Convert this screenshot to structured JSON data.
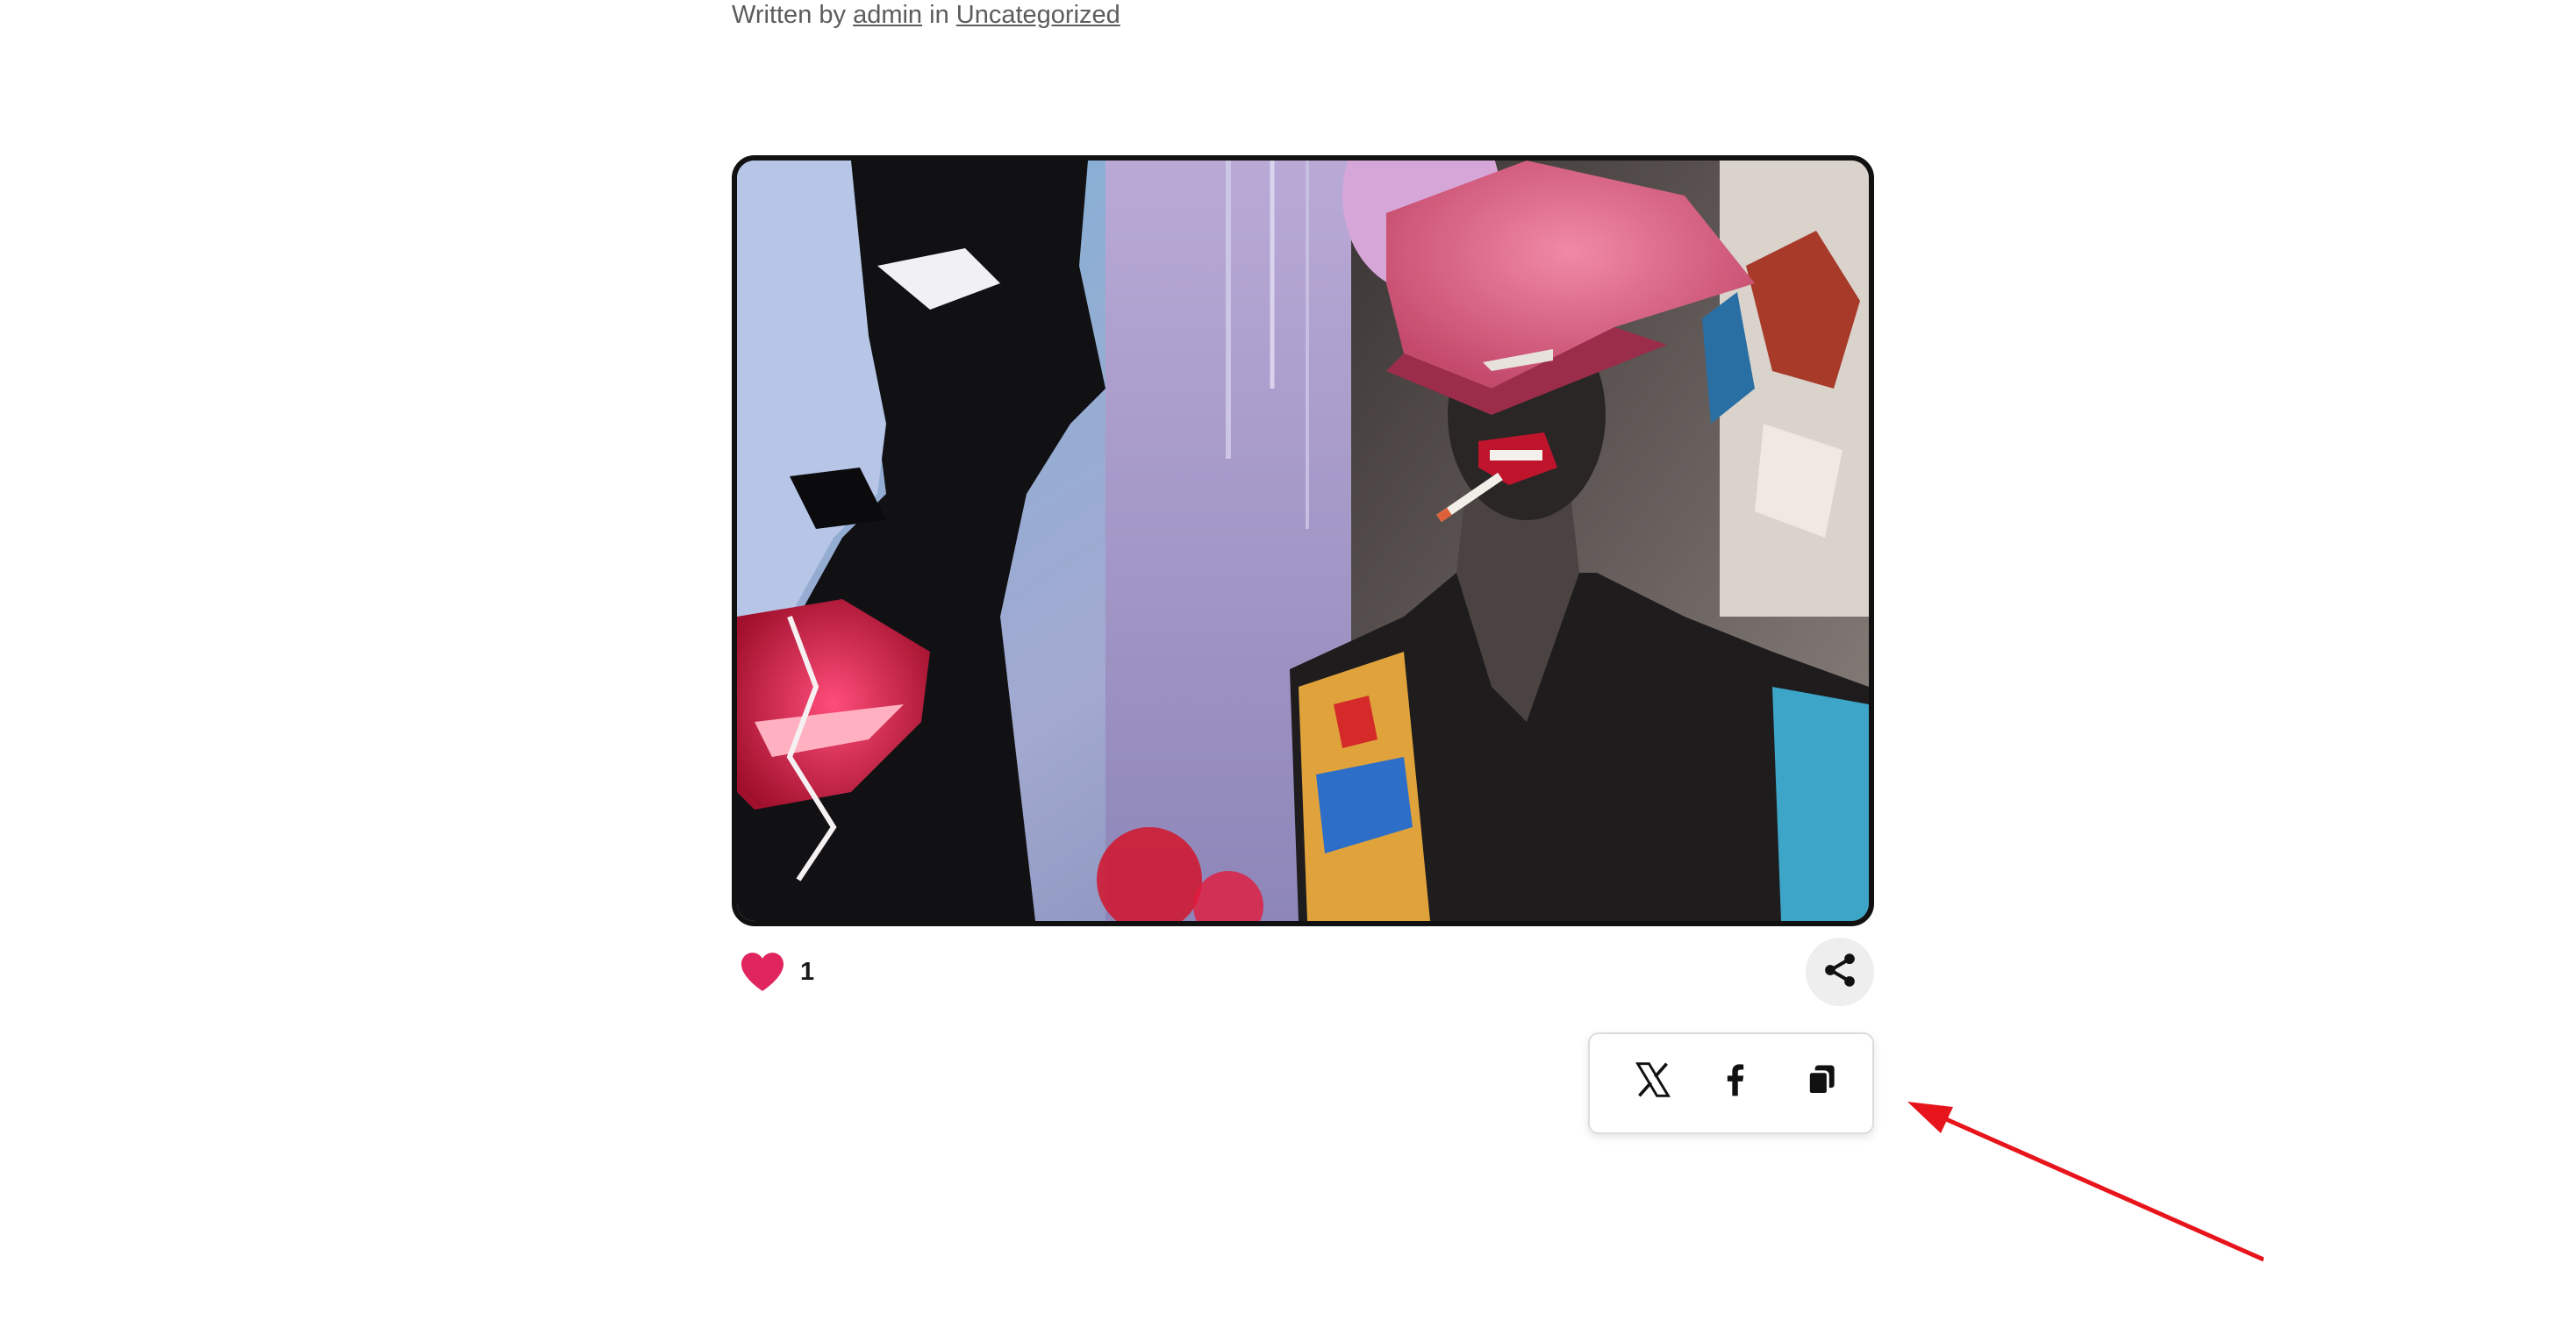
{
  "post_meta": {
    "written_by_label": "Written by",
    "author": "admin",
    "in_label": "in",
    "category": "Uncategorized"
  },
  "featured_image": {
    "icon": "featured-artwork-image"
  },
  "likes": {
    "icon": "heart-icon",
    "count": "1",
    "color": "#e0245e"
  },
  "share": {
    "toggle_icon": "share-icon",
    "options": [
      {
        "name": "X",
        "icon": "x-logo-icon"
      },
      {
        "name": "Facebook",
        "icon": "facebook-icon"
      },
      {
        "name": "Copy link",
        "icon": "copy-icon"
      }
    ]
  },
  "annotation": {
    "color": "#e8141b"
  }
}
